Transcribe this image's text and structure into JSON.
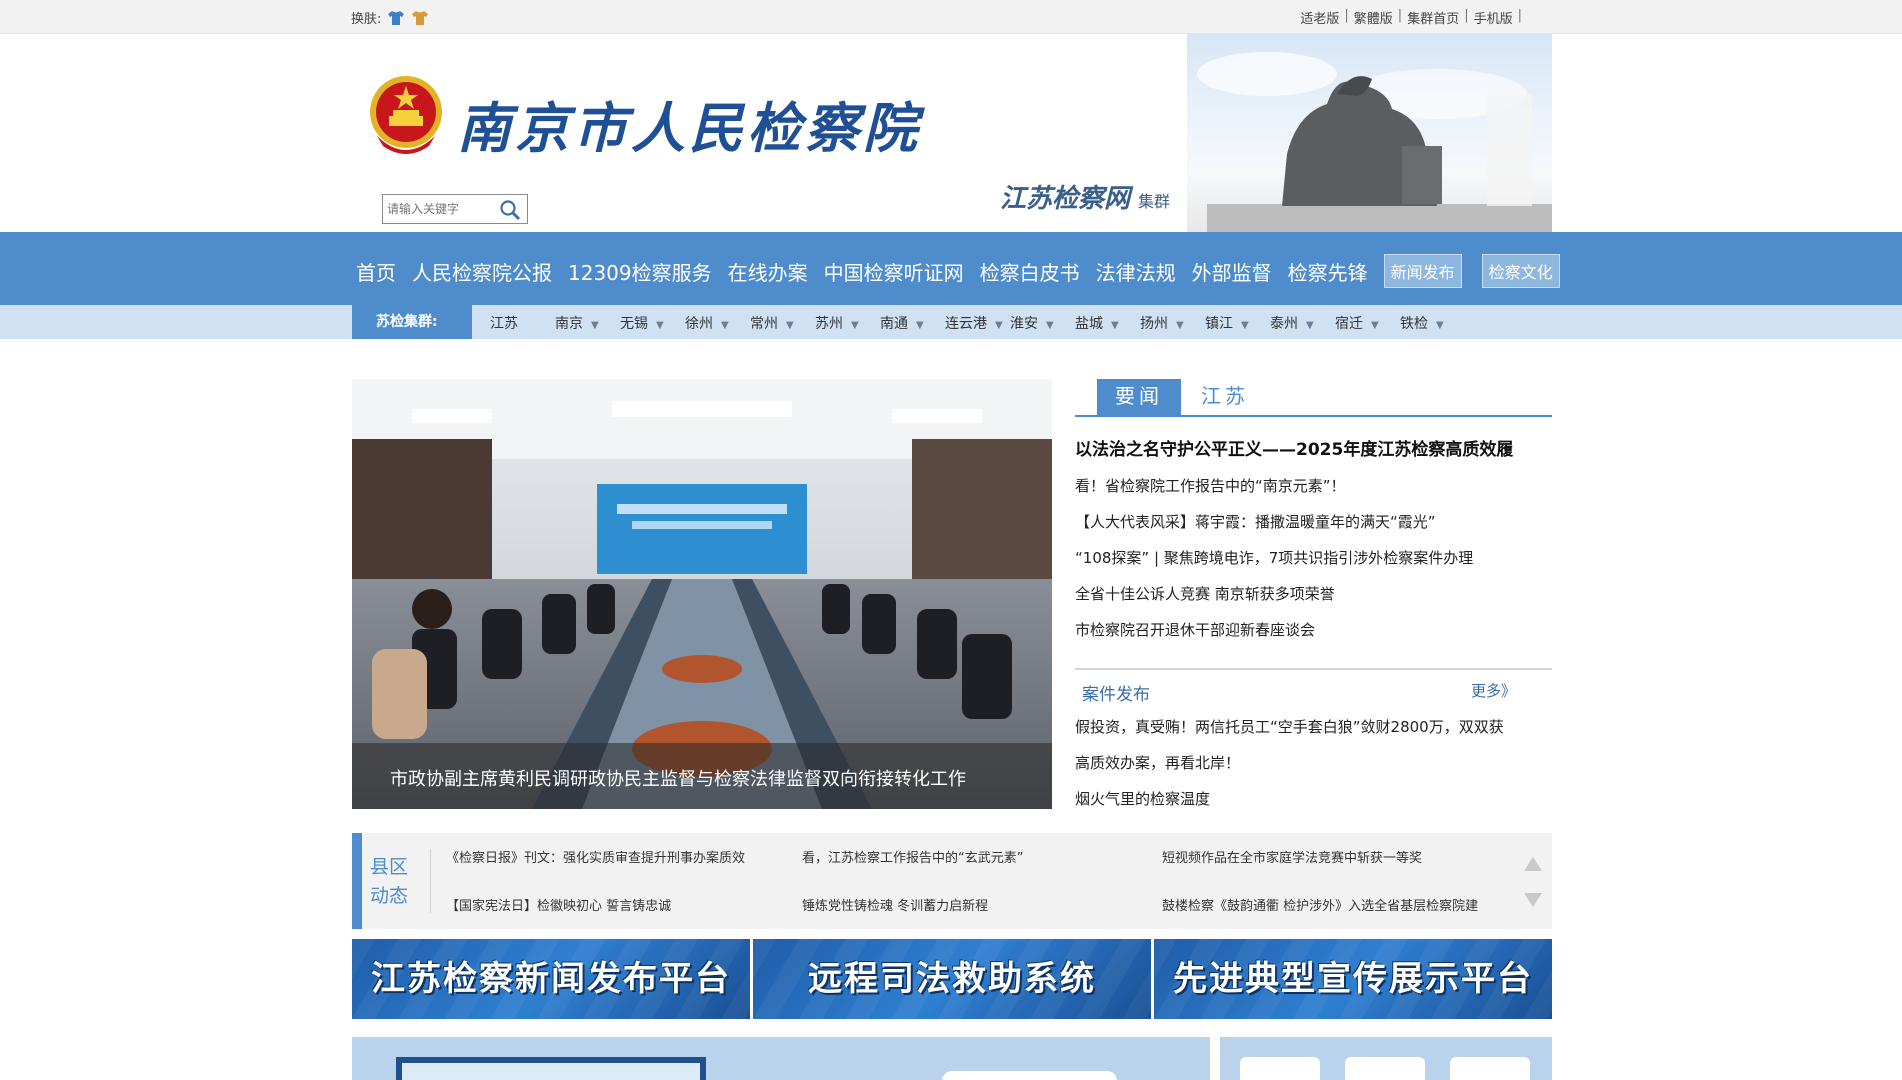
{
  "topbar": {
    "skin_label": "换肤:",
    "links": [
      "适老版",
      "繁體版",
      "集群首页",
      "手机版"
    ]
  },
  "header": {
    "site_title": "南京市人民检察院",
    "search_placeholder": "请输入关键字",
    "brand_main": "江苏检察网",
    "brand_sub": "集群"
  },
  "main_nav": {
    "items": [
      "首页",
      "人民检察院公报",
      "12309检察服务",
      "在线办案",
      "中国检察听证网",
      "检察白皮书",
      "法律法规",
      "外部监督",
      "检察先锋"
    ],
    "boxed_items": [
      "新闻发布",
      "检察文化"
    ]
  },
  "sub_nav": {
    "label": "苏检集群:",
    "cities": [
      "江苏",
      "南京",
      "无锡",
      "徐州",
      "常州",
      "苏州",
      "南通",
      "连云港",
      "淮安",
      "盐城",
      "扬州",
      "镇江",
      "泰州",
      "宿迁",
      "铁检"
    ]
  },
  "hero": {
    "caption": "市政协副主席黄利民调研政协民主监督与检察法律监督双向衔接转化工作"
  },
  "news": {
    "tab_active": "要闻",
    "tab_other": "江苏",
    "headline": "以法治之名守护公平正义——2025年度江苏检察高质效履",
    "items": [
      "看！省检察院工作报告中的“南京元素”！",
      "【人大代表风采】蒋宇霞：播撒温暖童年的满天“霞光”",
      "“108探案” | 聚焦跨境电诈，7项共识指引涉外检察案件办理",
      "全省十佳公诉人竞赛 南京斩获多项荣誉",
      "市检察院召开退休干部迎新春座谈会"
    ],
    "cases_title": "案件发布",
    "more": "更多》",
    "cases": [
      "假投资，真受贿！两信托员工“空手套白狼”敛财2800万，双双获",
      "高质效办案，再看北岸！",
      "烟火气里的检察温度"
    ]
  },
  "county": {
    "label": "县区动态",
    "items": [
      "《检察日报》刊文：强化实质审查提升刑事办案质效",
      "看，江苏检察工作报告中的“玄武元素”",
      "短视频作品在全市家庭学法竞赛中斩获一等奖",
      "【国家宪法日】检徽映初心 誓言铸忠诚",
      "锤炼党性铸检魂 冬训蓄力启新程",
      "鼓楼检察《鼓韵通衢 检护涉外》入选全省基层检察院建"
    ]
  },
  "banners": [
    "江苏检察新闻发布平台",
    "远程司法救助系统",
    "先进典型宣传展示平台"
  ]
}
